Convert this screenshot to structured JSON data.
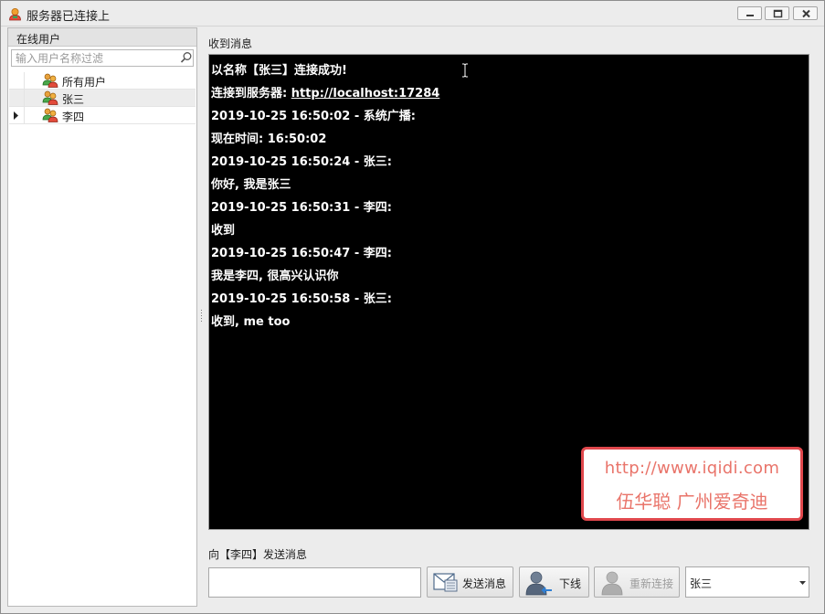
{
  "window": {
    "title": "服务器已连接上"
  },
  "left_panel": {
    "header": "在线用户",
    "filter_placeholder": "输入用户名称过滤",
    "users": [
      {
        "name": "所有用户"
      },
      {
        "name": "张三"
      },
      {
        "name": "李四"
      }
    ]
  },
  "receive": {
    "label": "收到消息",
    "lines": [
      "以名称【张三】连接成功!",
      "连接到服务器: ",
      "2019-10-25 16:50:02 - 系统广播:",
      " 现在时间: 16:50:02",
      "2019-10-25 16:50:24 - 张三:",
      " 你好, 我是张三",
      "2019-10-25 16:50:31 - 李四:",
      " 收到",
      "2019-10-25 16:50:47 - 李四:",
      " 我是李四, 很高兴认识你",
      "2019-10-25 16:50:58 - 张三:",
      " 收到, me too"
    ],
    "server_url": "http://localhost:17284"
  },
  "watermark": {
    "line1": "http://www.iqidi.com",
    "line2": "伍华聪 广州爱奇迪",
    "color": "#e0474c"
  },
  "send": {
    "label": "向【李四】发送消息",
    "input_value": "",
    "send_button": "发送消息",
    "offline_button": "下线",
    "reconnect_button": "重新连接",
    "user_select_value": "张三"
  }
}
